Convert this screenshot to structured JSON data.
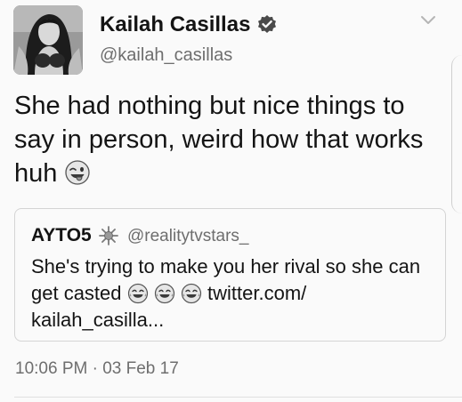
{
  "tweet": {
    "display_name": "Kailah Casillas",
    "handle": "@kailah_casillas",
    "text_line1": "She had nothing but nice things to",
    "text_line2": "say in person, weird how that works",
    "text_line3": "huh",
    "emoji": "winking-face-tongue-out",
    "timestamp": "10:06 PM · 03 Feb 17"
  },
  "quoted": {
    "display_name": "AYTO5",
    "handle": "@realitytvstars_",
    "text_line1": "She's trying to make you her rival so she can",
    "text_line2_prefix": "get casted",
    "link": "twitter.com/",
    "text_line3": "kailah_casilla...",
    "emojis": [
      "face-with-tears-of-joy",
      "face-with-tears-of-joy",
      "face-with-tears-of-joy"
    ]
  },
  "icons": {
    "verified": "verified-badge-icon",
    "menu": "chevron-down-icon",
    "quote_badge": "sparkle-badge-icon"
  },
  "colors": {
    "text": "#141414",
    "secondary_text": "#6e6e6e",
    "border": "#d4d4d4",
    "background": "#fafafa"
  }
}
